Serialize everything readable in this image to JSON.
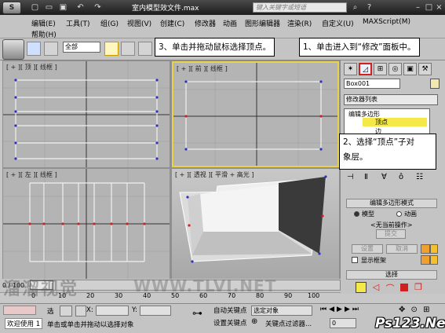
{
  "titlebar": {
    "app_icon": "3ds-max-logo",
    "title": "室内模型效文件.max",
    "search_placeholder": "键入关键字或短语"
  },
  "menubar": {
    "items": [
      "编辑(E)",
      "工具(T)",
      "组(G)",
      "视图(V)",
      "创建(C)",
      "修改器",
      "动画",
      "图形编辑器",
      "渲染(R)",
      "自定义(U)",
      "MAXScript(M)",
      "帮助(H)"
    ]
  },
  "toolbar": {
    "selection_filter": "全部"
  },
  "callouts": {
    "step1": "1、单击进入到“修改”面板中。",
    "step2_line1": "2、选择“顶点”子对",
    "step2_line2": "象层。",
    "step3": "3、单击并拖动鼠标选择顶点。"
  },
  "viewports": {
    "top": "[ + ][ 顶 ][ 线框 ]",
    "front": "[ + ][ 前 ][ 线框 ]",
    "left": "[ + ][ 左 ][ 线框 ]",
    "perspective": "[ + ][ 透视 ][ 平滑 + 高光 ]"
  },
  "command_panel": {
    "object_name": "Box001",
    "object_color": "#f0e8b0",
    "modifier_list": "修改器列表",
    "stack": {
      "modifier": "编辑多边形",
      "sub_vertex": "顶点",
      "sub_edge": "边"
    },
    "rollout_mode": "编辑多边形模式",
    "mode_model": "模型",
    "mode_animation": "动画",
    "no_operation": "<无当前操作>",
    "commit": "提交",
    "settings": "设置",
    "cancel": "取消",
    "show_cage": "显示框架",
    "rollout_select": "选择"
  },
  "timeline": {
    "frame": "0 / 100",
    "ticks": [
      "0",
      "10",
      "20",
      "30",
      "40",
      "50",
      "60",
      "70",
      "80",
      "90",
      "100"
    ]
  },
  "statusbar": {
    "welcome": "欢迎使用 1",
    "selected": "选",
    "x_label": "X:",
    "y_label": "Y:",
    "prompt": "单击或单击并拖动以选择对象",
    "auto_key": "自动关键点",
    "set_key": "设置关键点",
    "selected_object": "选定对象",
    "key_filters": "关键点过滤器...",
    "frame_value": "0"
  },
  "watermarks": {
    "site_cn": "溜溜视觉",
    "site_url": "WWW.TLVI.NET",
    "ps123": "Ps123.Net"
  }
}
